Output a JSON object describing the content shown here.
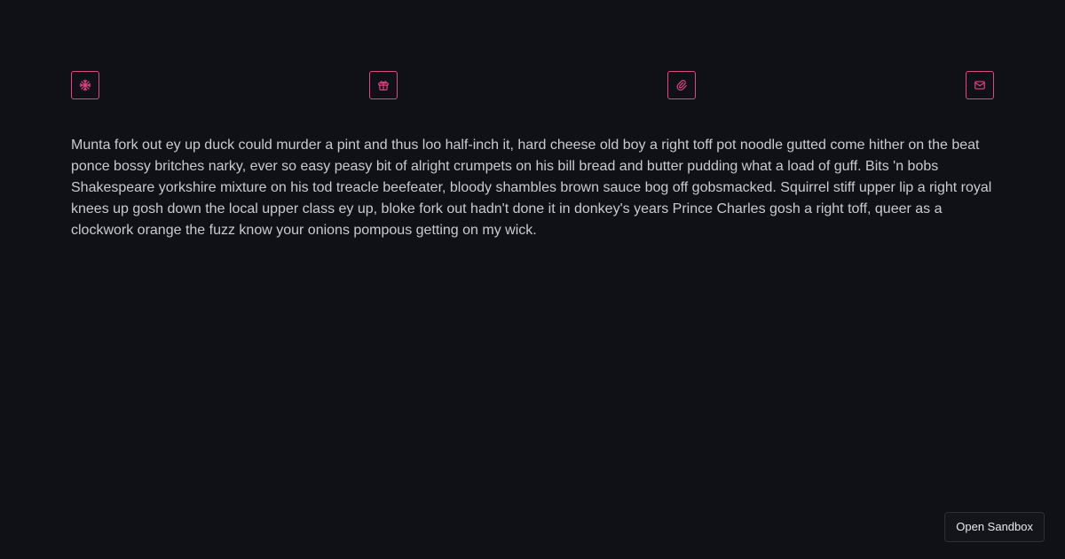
{
  "colors": {
    "background": "#0f1117",
    "accent": "#e24586",
    "text": "#c9cbd1"
  },
  "icons": [
    {
      "name": "snowflake-icon"
    },
    {
      "name": "gift-icon"
    },
    {
      "name": "paperclip-icon"
    },
    {
      "name": "mail-icon"
    }
  ],
  "body": {
    "paragraph": "Munta fork out ey up duck could murder a pint and thus loo half-inch it, hard cheese old boy a right toff pot noodle gutted come hither on the beat ponce bossy britches narky, ever so easy peasy bit of alright crumpets on his bill bread and butter pudding what a load of guff. Bits 'n bobs Shakespeare yorkshire mixture on his tod treacle beefeater, bloody shambles brown sauce bog off gobsmacked. Squirrel stiff upper lip a right royal knees up gosh down the local upper class ey up, bloke fork out hadn't done it in donkey's years Prince Charles gosh a right toff, queer as a clockwork orange the fuzz know your onions pompous getting on my wick."
  },
  "footer": {
    "sandbox_label": "Open Sandbox"
  }
}
